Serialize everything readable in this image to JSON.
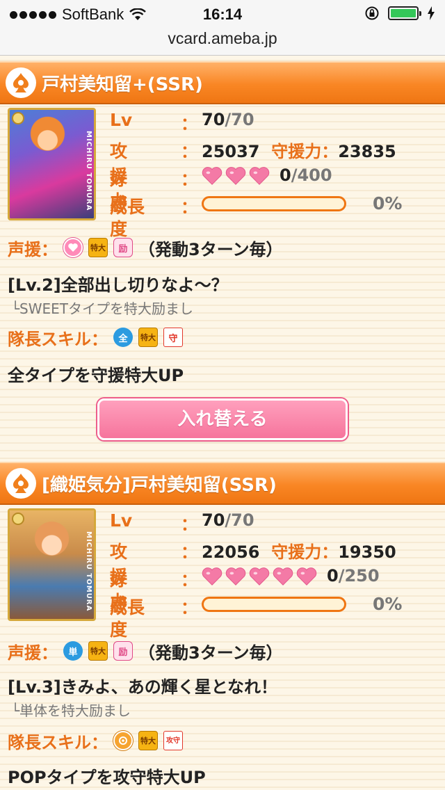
{
  "status_bar": {
    "carrier": "SoftBank",
    "time": "16:14",
    "url": "vcard.ameba.jp"
  },
  "labels": {
    "lv": "Lv",
    "colon": "：",
    "attack": "攻援力",
    "defense": "守援力",
    "affection": "好感度",
    "growth": "成長",
    "voice_skill": "声援：",
    "leader_skill": "隊長スキル：",
    "trigger": "（発動3ターン毎）",
    "swap_button": "入れ替える"
  },
  "cards": [
    {
      "title": "戸村美知留+(SSR)",
      "card_name_vertical": "MICHIRU TOMURA",
      "level": "70",
      "level_max": "/70",
      "attack": "25037",
      "defense": "23835",
      "hearts": 3,
      "affection": "0",
      "affection_max": "/400",
      "growth_percent": "0%",
      "growth_value": 0,
      "voice_icons": [
        "sweet-type-icon",
        "special-large-icon",
        "cheer-icon"
      ],
      "voice_skill_name": "[Lv.2]全部出し切りなよ〜？",
      "voice_skill_desc": "└SWEETタイプを特大励まし",
      "leader_icons": [
        "all-type-icon",
        "special-large-icon",
        "guard-icon"
      ],
      "leader_skill_desc": "全タイプを守援特大UP"
    },
    {
      "title": "[織姫気分]戸村美知留(SSR)",
      "card_name_vertical": "MICHIRU TOMURA",
      "level": "70",
      "level_max": "/70",
      "attack": "22056",
      "defense": "19350",
      "hearts": 5,
      "affection": "0",
      "affection_max": "/250",
      "growth_percent": "0%",
      "growth_value": 0,
      "voice_icons": [
        "single-target-icon",
        "special-large-icon",
        "cheer-icon"
      ],
      "voice_skill_name": "[Lv.3]きみよ、あの輝く星となれ！",
      "voice_skill_desc": "└単体を特大励まし",
      "leader_icons": [
        "pop-type-icon",
        "special-large-icon",
        "attack-defense-icon"
      ],
      "leader_skill_desc": "POPタイプを攻守特大UP"
    }
  ],
  "icon_text": {
    "special": "特大",
    "cheer": "励",
    "all": "全",
    "single": "単",
    "guard": "守",
    "atk": "攻",
    "def": "守"
  },
  "colors": {
    "header_orange": "#f98624",
    "label_orange": "#e8701a",
    "button_pink": "#f6749c"
  }
}
